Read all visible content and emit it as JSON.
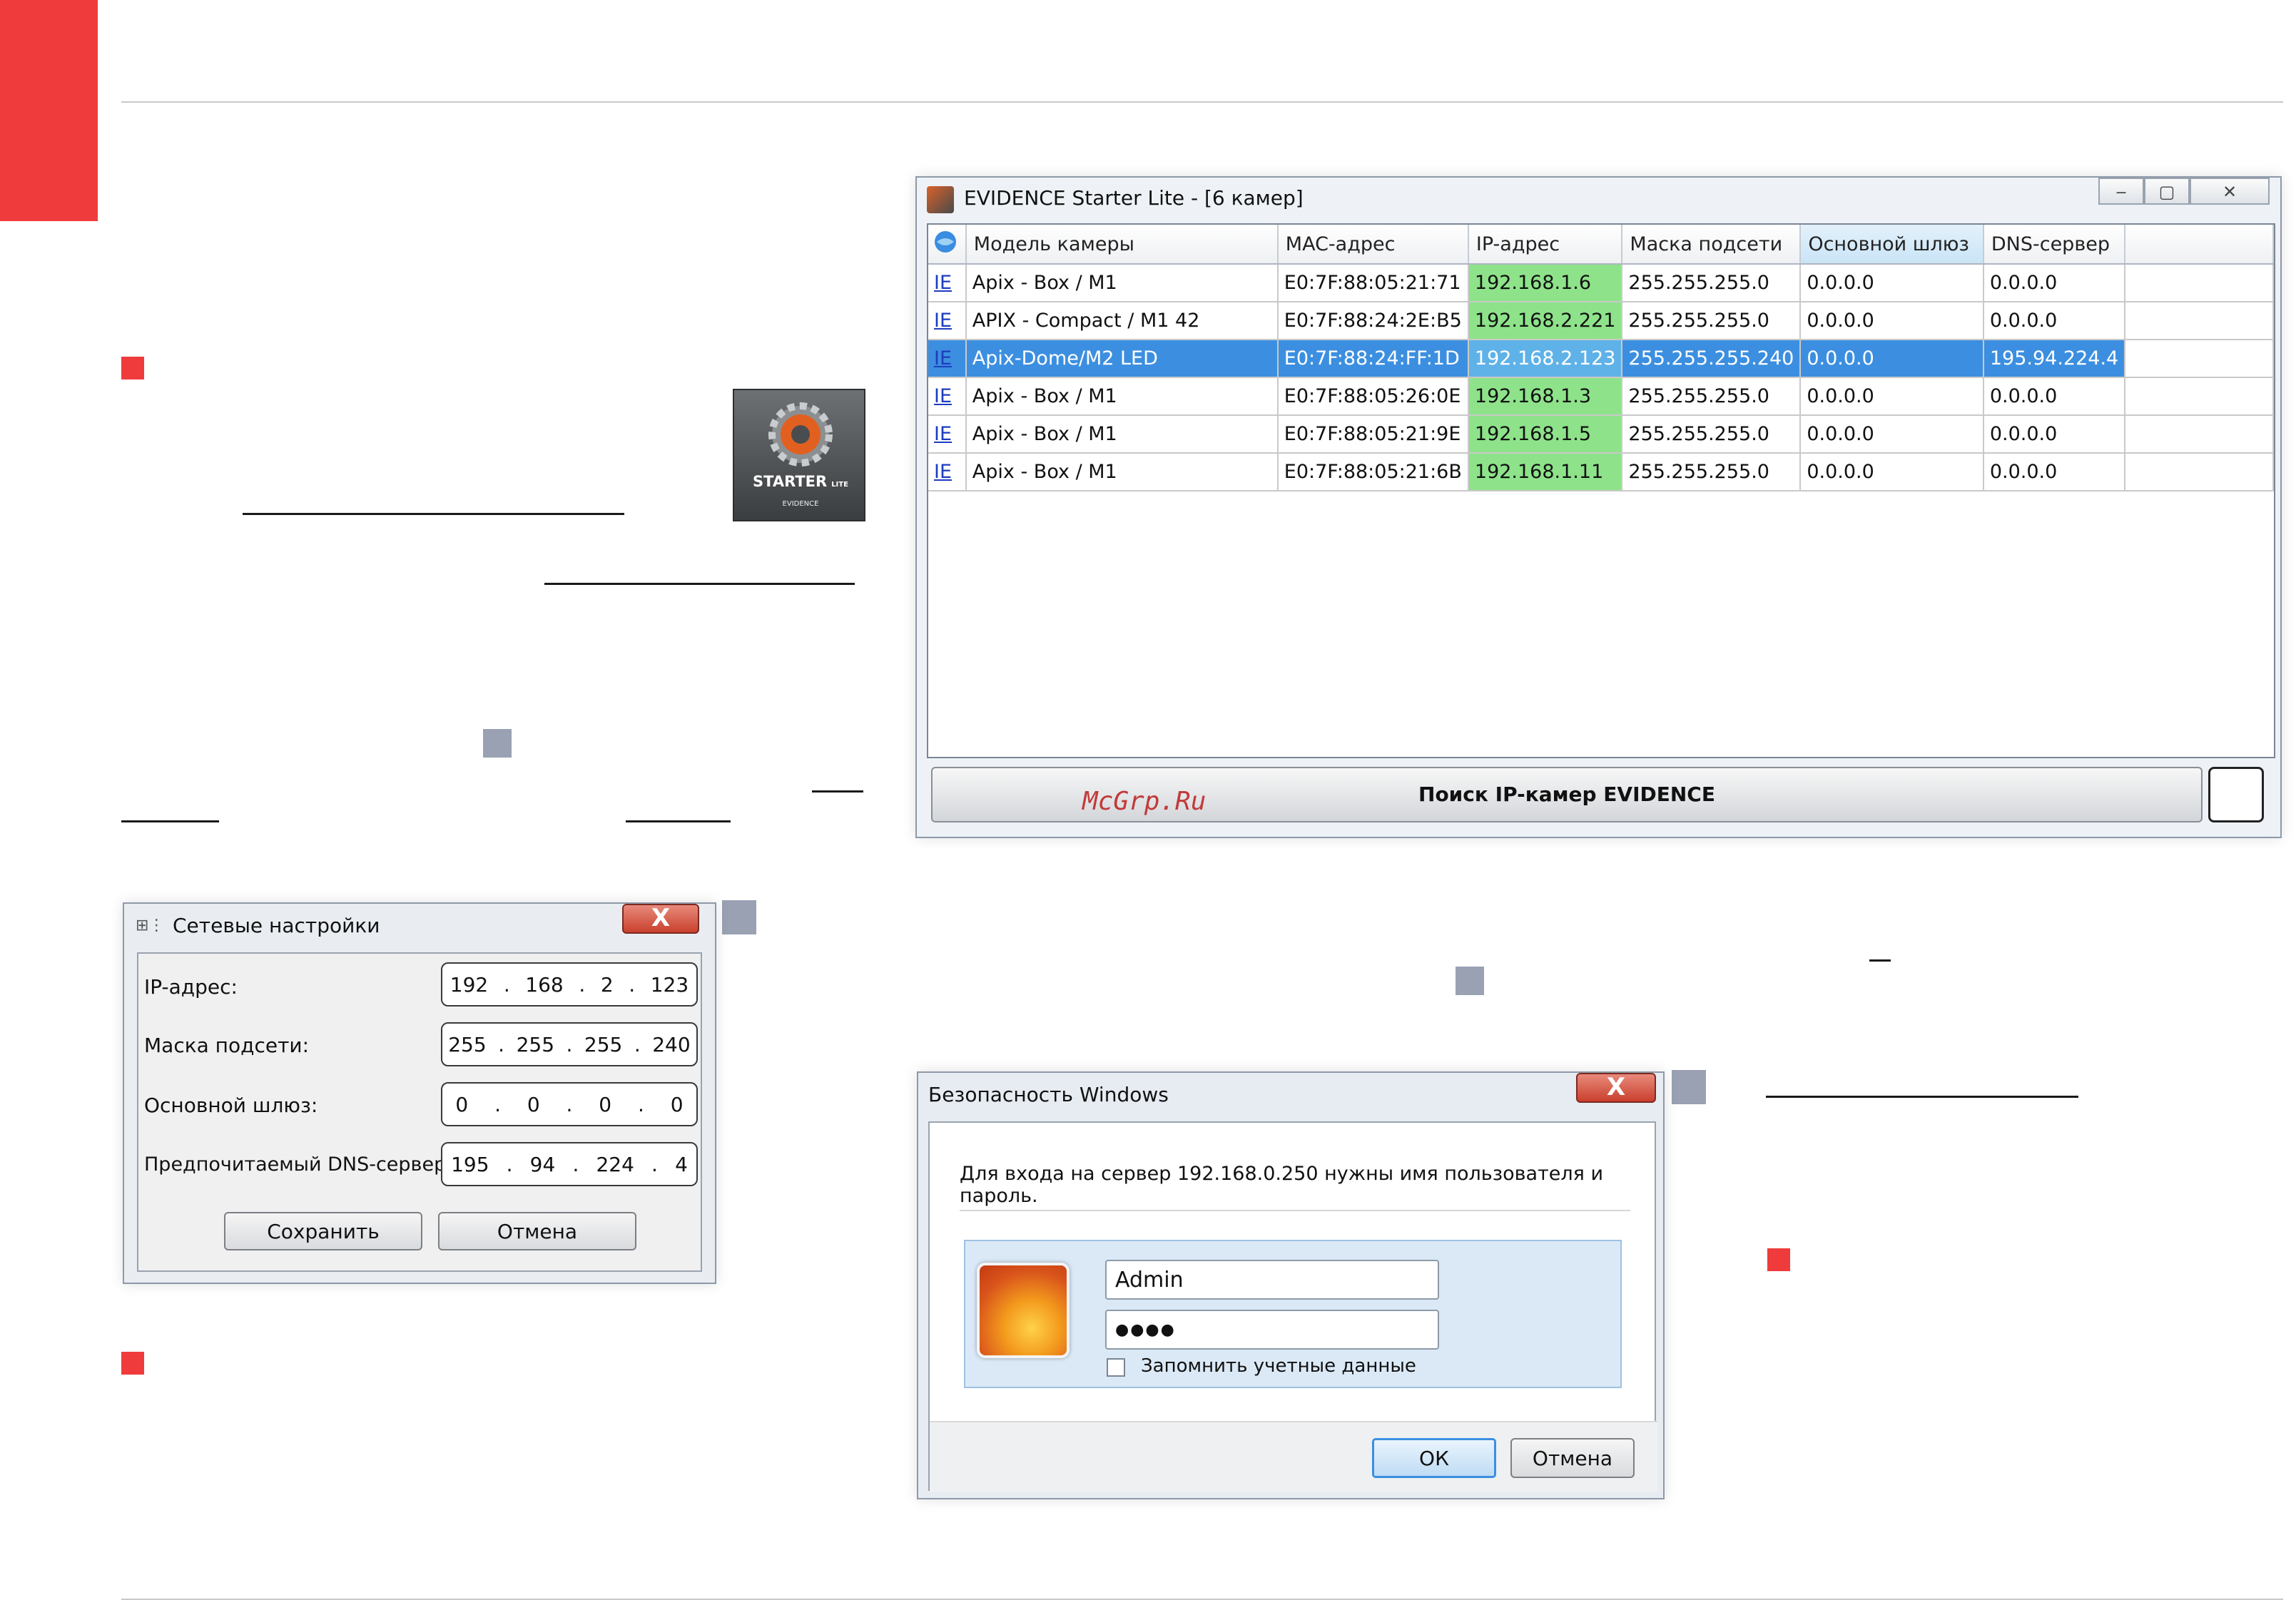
{
  "starter_window": {
    "title": "EVIDENCE Starter  Lite - [6 камер]",
    "columns": [
      "Модель камеры",
      "MAC-адрес",
      "IP-адрес",
      "Маска подсети",
      "Основной шлюз",
      "DNS-сервер"
    ],
    "link_label": "IE",
    "rows": [
      {
        "model": "Apix - Box / M1",
        "mac": "E0:7F:88:05:21:71",
        "ip": "192.168.1.6",
        "mask": "255.255.255.0",
        "gateway": "0.0.0.0",
        "dns": "0.0.0.0"
      },
      {
        "model": "APIX - Compact / M1 42",
        "mac": "E0:7F:88:24:2E:B5",
        "ip": "192.168.2.221",
        "mask": "255.255.255.0",
        "gateway": "0.0.0.0",
        "dns": "0.0.0.0"
      },
      {
        "model": "Apix-Dome/M2 LED",
        "mac": "E0:7F:88:24:FF:1D",
        "ip": "192.168.2.123",
        "mask": "255.255.255.240",
        "gateway": "0.0.0.0",
        "dns": "195.94.224.4"
      },
      {
        "model": "Apix - Box / M1",
        "mac": "E0:7F:88:05:26:0E",
        "ip": "192.168.1.3",
        "mask": "255.255.255.0",
        "gateway": "0.0.0.0",
        "dns": "0.0.0.0"
      },
      {
        "model": "Apix - Box / M1",
        "mac": "E0:7F:88:05:21:9E",
        "ip": "192.168.1.5",
        "mask": "255.255.255.0",
        "gateway": "0.0.0.0",
        "dns": "0.0.0.0"
      },
      {
        "model": "Apix - Box / M1",
        "mac": "E0:7F:88:05:21:6B",
        "ip": "192.168.1.11",
        "mask": "255.255.255.0",
        "gateway": "0.0.0.0",
        "dns": "0.0.0.0"
      }
    ],
    "search_button": "Поиск IP-камер EVIDENCE",
    "watermark": "McGrp.Ru",
    "colors": {
      "ip_cell": "#8ee38a",
      "selected_row": "#3c8fe0"
    }
  },
  "app_icon": {
    "label": "STARTER",
    "sublabel": "LITE",
    "brand": "EVIDENCE"
  },
  "net_dialog": {
    "title": "Сетевые настройки",
    "close": "X",
    "fields": [
      {
        "label": "IP-адрес:",
        "octets": [
          "192",
          "168",
          "2",
          "123"
        ]
      },
      {
        "label": "Маска подсети:",
        "octets": [
          "255",
          "255",
          "255",
          "240"
        ]
      },
      {
        "label": "Основной шлюз:",
        "octets": [
          "0",
          "0",
          "0",
          "0"
        ]
      },
      {
        "label": "Предпочитаемый DNS-сервер:",
        "octets": [
          "195",
          "94",
          "224",
          "4"
        ]
      }
    ],
    "save": "Сохранить",
    "cancel": "Отмена"
  },
  "security_dialog": {
    "title": "Безопасность Windows",
    "close": "X",
    "message": "Для входа на сервер 192.168.0.250 нужны имя пользователя и пароль.",
    "username": "Admin",
    "password_mask": "●●●●",
    "remember": "Запомнить учетные данные",
    "ok": "ОК",
    "cancel": "Отмена"
  }
}
